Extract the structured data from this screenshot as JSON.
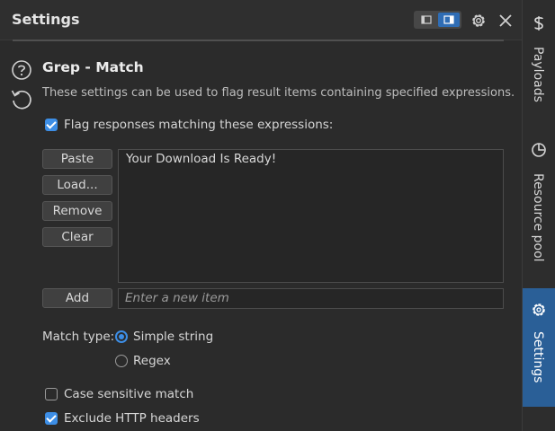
{
  "header": {
    "title": "Settings"
  },
  "section": {
    "title": "Grep - Match",
    "description": "These settings can be used to flag result items containing specified expressions."
  },
  "flag_responses": {
    "label": "Flag responses matching these expressions:",
    "checked": true
  },
  "list_buttons": {
    "paste": "Paste",
    "load": "Load...",
    "remove": "Remove",
    "clear": "Clear",
    "add": "Add"
  },
  "list_items": [
    "Your Download Is Ready!"
  ],
  "new_item": {
    "placeholder": "Enter a new item"
  },
  "match_type": {
    "label": "Match type:",
    "options": [
      "Simple string",
      "Regex"
    ],
    "selected": "Simple string"
  },
  "case_sensitive": {
    "label": "Case sensitive match",
    "checked": false
  },
  "exclude_headers": {
    "label": "Exclude HTTP headers",
    "checked": true
  },
  "sidebar": {
    "tabs": [
      {
        "label": "Payloads",
        "icon": "dollar-icon"
      },
      {
        "label": "Resource pool",
        "icon": "pie-chart-icon"
      },
      {
        "label": "Settings",
        "icon": "gear-icon",
        "active": true
      }
    ]
  },
  "colors": {
    "accent": "#3d8ee6",
    "active_tab": "#2a5f97",
    "background": "#2b2b2b"
  }
}
